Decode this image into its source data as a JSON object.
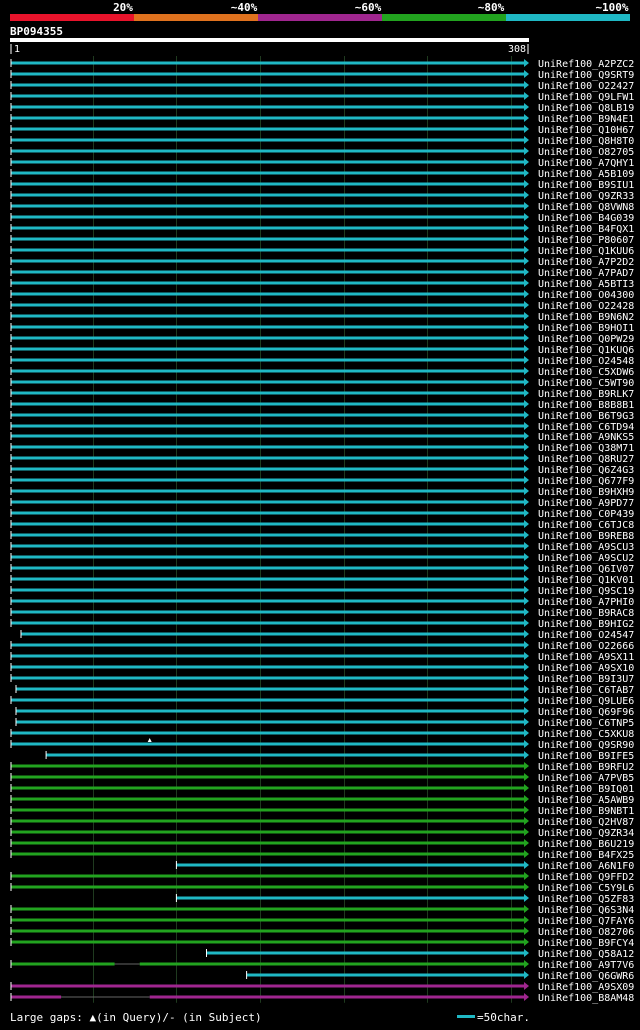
{
  "percent_labels": [
    "20%",
    "~40%",
    "~60%",
    "~80%",
    "~100%"
  ],
  "percent_colors": [
    "#e8132b",
    "#e0721e",
    "#a0268f",
    "#22a31f",
    "#1fb8c4"
  ],
  "query": {
    "name": "BP094355",
    "start": "1",
    "end": "308"
  },
  "footer": {
    "large_gaps": "Large gaps: ▲(in Query)/- (in Subject)",
    "scale_note": "=50char."
  },
  "chart_data": {
    "type": "alignment-overview",
    "query_length": 308,
    "gridlines": [
      50,
      100,
      150,
      200,
      250,
      300
    ],
    "color_by_identity": {
      "cyan": "~100%",
      "green": "~80%",
      "purple": "~60%"
    },
    "hits": [
      {
        "name": "UniRef100_A2PZC2",
        "start": 1,
        "end": 308,
        "color": "cyan"
      },
      {
        "name": "UniRef100_Q9SRT9",
        "start": 1,
        "end": 308,
        "color": "cyan"
      },
      {
        "name": "UniRef100_O22427",
        "start": 1,
        "end": 308,
        "color": "cyan"
      },
      {
        "name": "UniRef100_Q9LFW1",
        "start": 1,
        "end": 308,
        "color": "cyan"
      },
      {
        "name": "UniRef100_Q8LB19",
        "start": 1,
        "end": 308,
        "color": "cyan"
      },
      {
        "name": "UniRef100_B9N4E1",
        "start": 1,
        "end": 308,
        "color": "cyan"
      },
      {
        "name": "UniRef100_Q10H67",
        "start": 1,
        "end": 308,
        "color": "cyan"
      },
      {
        "name": "UniRef100_Q8H8T0",
        "start": 1,
        "end": 308,
        "color": "cyan"
      },
      {
        "name": "UniRef100_O82705",
        "start": 1,
        "end": 308,
        "color": "cyan"
      },
      {
        "name": "UniRef100_A7QHY1",
        "start": 1,
        "end": 308,
        "color": "cyan"
      },
      {
        "name": "UniRef100_A5B109",
        "start": 1,
        "end": 308,
        "color": "cyan"
      },
      {
        "name": "UniRef100_B9SIU1",
        "start": 1,
        "end": 308,
        "color": "cyan"
      },
      {
        "name": "UniRef100_Q9ZR33",
        "start": 1,
        "end": 308,
        "color": "cyan"
      },
      {
        "name": "UniRef100_Q8VWN8",
        "start": 1,
        "end": 308,
        "color": "cyan"
      },
      {
        "name": "UniRef100_B4G039",
        "start": 1,
        "end": 308,
        "color": "cyan"
      },
      {
        "name": "UniRef100_B4FQX1",
        "start": 1,
        "end": 308,
        "color": "cyan"
      },
      {
        "name": "UniRef100_P80607",
        "start": 1,
        "end": 308,
        "color": "cyan"
      },
      {
        "name": "UniRef100_Q1KUU6",
        "start": 1,
        "end": 308,
        "color": "cyan"
      },
      {
        "name": "UniRef100_A7P2D2",
        "start": 1,
        "end": 308,
        "color": "cyan"
      },
      {
        "name": "UniRef100_A7PAD7",
        "start": 1,
        "end": 308,
        "color": "cyan"
      },
      {
        "name": "UniRef100_A5BTI3",
        "start": 1,
        "end": 308,
        "color": "cyan"
      },
      {
        "name": "UniRef100_O04300",
        "start": 1,
        "end": 308,
        "color": "cyan"
      },
      {
        "name": "UniRef100_O22428",
        "start": 1,
        "end": 308,
        "color": "cyan"
      },
      {
        "name": "UniRef100_B9N6N2",
        "start": 1,
        "end": 308,
        "color": "cyan"
      },
      {
        "name": "UniRef100_B9HOI1",
        "start": 1,
        "end": 308,
        "color": "cyan"
      },
      {
        "name": "UniRef100_Q0PW29",
        "start": 1,
        "end": 308,
        "color": "cyan"
      },
      {
        "name": "UniRef100_Q1KUQ6",
        "start": 1,
        "end": 308,
        "color": "cyan"
      },
      {
        "name": "UniRef100_O24548",
        "start": 1,
        "end": 308,
        "color": "cyan"
      },
      {
        "name": "UniRef100_C5XDW6",
        "start": 1,
        "end": 308,
        "color": "cyan"
      },
      {
        "name": "UniRef100_C5WT90",
        "start": 1,
        "end": 308,
        "color": "cyan"
      },
      {
        "name": "UniRef100_B9RLK7",
        "start": 1,
        "end": 308,
        "color": "cyan"
      },
      {
        "name": "UniRef100_B8B8B1",
        "start": 1,
        "end": 308,
        "color": "cyan"
      },
      {
        "name": "UniRef100_B6T9G3",
        "start": 1,
        "end": 308,
        "color": "cyan"
      },
      {
        "name": "UniRef100_C6TD94",
        "start": 1,
        "end": 308,
        "color": "cyan"
      },
      {
        "name": "UniRef100_A9NKS5",
        "start": 1,
        "end": 308,
        "color": "cyan"
      },
      {
        "name": "UniRef100_Q38M71",
        "start": 1,
        "end": 308,
        "color": "cyan"
      },
      {
        "name": "UniRef100_Q8RU27",
        "start": 1,
        "end": 308,
        "color": "cyan"
      },
      {
        "name": "UniRef100_Q6Z4G3",
        "start": 1,
        "end": 308,
        "color": "cyan"
      },
      {
        "name": "UniRef100_Q677F9",
        "start": 1,
        "end": 308,
        "color": "cyan"
      },
      {
        "name": "UniRef100_B9HXH9",
        "start": 1,
        "end": 308,
        "color": "cyan"
      },
      {
        "name": "UniRef100_A9PD77",
        "start": 1,
        "end": 308,
        "color": "cyan"
      },
      {
        "name": "UniRef100_C0P439",
        "start": 1,
        "end": 308,
        "color": "cyan"
      },
      {
        "name": "UniRef100_C6TJC8",
        "start": 1,
        "end": 308,
        "color": "cyan"
      },
      {
        "name": "UniRef100_B9REB8",
        "start": 1,
        "end": 308,
        "color": "cyan"
      },
      {
        "name": "UniRef100_A9SCU3",
        "start": 1,
        "end": 308,
        "color": "cyan"
      },
      {
        "name": "UniRef100_A9SCU2",
        "start": 1,
        "end": 308,
        "color": "cyan"
      },
      {
        "name": "UniRef100_Q6IV07",
        "start": 1,
        "end": 308,
        "color": "cyan"
      },
      {
        "name": "UniRef100_Q1KV01",
        "start": 1,
        "end": 308,
        "color": "cyan"
      },
      {
        "name": "UniRef100_Q9SC19",
        "start": 1,
        "end": 308,
        "color": "cyan"
      },
      {
        "name": "UniRef100_A7PHI0",
        "start": 1,
        "end": 308,
        "color": "cyan"
      },
      {
        "name": "UniRef100_B9RAC8",
        "start": 1,
        "end": 308,
        "color": "cyan"
      },
      {
        "name": "UniRef100_B9HIG2",
        "start": 1,
        "end": 308,
        "color": "cyan"
      },
      {
        "name": "UniRef100_O24547",
        "start": 7,
        "end": 308,
        "color": "cyan"
      },
      {
        "name": "UniRef100_O22666",
        "start": 1,
        "end": 308,
        "color": "cyan"
      },
      {
        "name": "UniRef100_A9SX11",
        "start": 1,
        "end": 308,
        "color": "cyan"
      },
      {
        "name": "UniRef100_A9SX10",
        "start": 1,
        "end": 308,
        "color": "cyan"
      },
      {
        "name": "UniRef100_B9I3U7",
        "start": 1,
        "end": 308,
        "color": "cyan"
      },
      {
        "name": "UniRef100_C6TAB7",
        "start": 4,
        "end": 308,
        "color": "cyan"
      },
      {
        "name": "UniRef100_Q9LUE6",
        "start": 1,
        "end": 308,
        "color": "cyan"
      },
      {
        "name": "UniRef100_Q69F96",
        "start": 4,
        "end": 308,
        "color": "cyan"
      },
      {
        "name": "UniRef100_C6TNP5",
        "start": 4,
        "end": 308,
        "color": "cyan"
      },
      {
        "name": "UniRef100_C5XKU8",
        "start": 1,
        "end": 308,
        "color": "cyan"
      },
      {
        "name": "UniRef100_Q9SR90",
        "start": 1,
        "end": 308,
        "color": "cyan",
        "gap_at": 84
      },
      {
        "name": "UniRef100_B9IFE5",
        "start": 22,
        "end": 308,
        "color": "cyan"
      },
      {
        "name": "UniRef100_B9RFU2",
        "start": 1,
        "end": 308,
        "color": "green"
      },
      {
        "name": "UniRef100_A7PVB5",
        "start": 1,
        "end": 308,
        "color": "green"
      },
      {
        "name": "UniRef100_B9IQ01",
        "start": 1,
        "end": 308,
        "color": "green"
      },
      {
        "name": "UniRef100_A5AWB9",
        "start": 1,
        "end": 308,
        "color": "green"
      },
      {
        "name": "UniRef100_B9NBT1",
        "start": 1,
        "end": 308,
        "color": "green"
      },
      {
        "name": "UniRef100_Q2HV87",
        "start": 1,
        "end": 308,
        "color": "green"
      },
      {
        "name": "UniRef100_Q9ZR34",
        "start": 1,
        "end": 308,
        "color": "green"
      },
      {
        "name": "UniRef100_B6U219",
        "start": 1,
        "end": 308,
        "color": "green"
      },
      {
        "name": "UniRef100_B4FX25",
        "start": 1,
        "end": 308,
        "color": "green"
      },
      {
        "name": "UniRef100_A6N1F0",
        "start": 100,
        "end": 308,
        "color": "cyan"
      },
      {
        "name": "UniRef100_Q9FFD2",
        "start": 1,
        "end": 308,
        "color": "green"
      },
      {
        "name": "UniRef100_C5Y9L6",
        "start": 1,
        "end": 308,
        "color": "green"
      },
      {
        "name": "UniRef100_Q5ZF83",
        "start": 100,
        "end": 308,
        "color": "cyan"
      },
      {
        "name": "UniRef100_Q6S3N4",
        "start": 1,
        "end": 308,
        "color": "green"
      },
      {
        "name": "UniRef100_Q7FAY6",
        "start": 1,
        "end": 308,
        "color": "green"
      },
      {
        "name": "UniRef100_O82706",
        "start": 1,
        "end": 308,
        "color": "green"
      },
      {
        "name": "UniRef100_B9FCY4",
        "start": 1,
        "end": 308,
        "color": "green"
      },
      {
        "name": "UniRef100_Q58A12",
        "start": 118,
        "end": 308,
        "color": "cyan"
      },
      {
        "name": "UniRef100_A9T7V6",
        "start": 1,
        "end": 308,
        "color": "green",
        "gap_from": 63,
        "gap_to": 78
      },
      {
        "name": "UniRef100_Q6GWR6",
        "start": 142,
        "end": 308,
        "color": "cyan"
      },
      {
        "name": "UniRef100_A9SX09",
        "start": 1,
        "end": 308,
        "color": "purple"
      },
      {
        "name": "UniRef100_B8AM48",
        "start": 1,
        "end": 308,
        "color": "purple",
        "gap_from": 31,
        "gap_to": 84
      }
    ]
  }
}
